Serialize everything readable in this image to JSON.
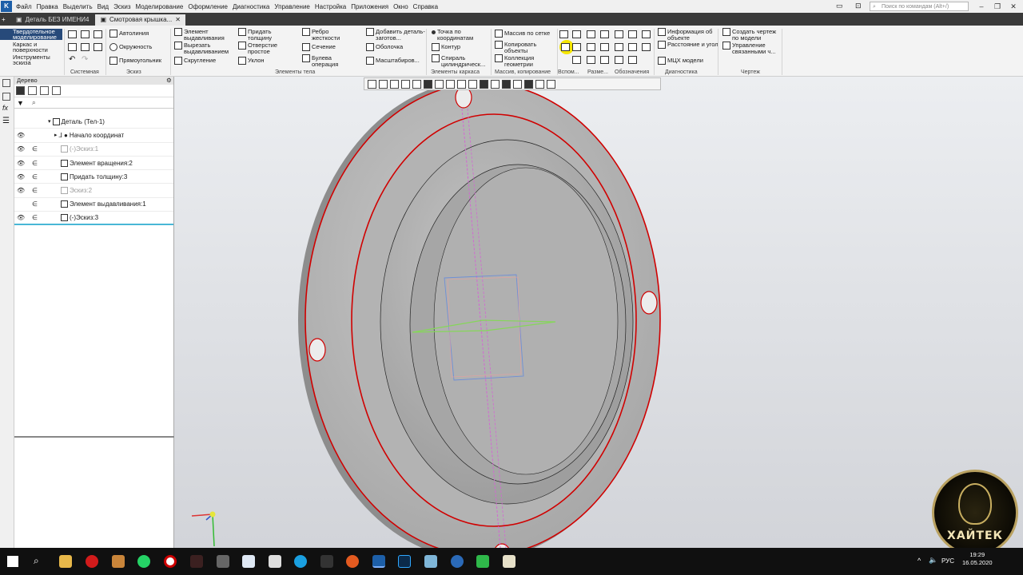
{
  "menu": [
    "Файл",
    "Правка",
    "Выделить",
    "Вид",
    "Эскиз",
    "Моделирование",
    "Оформление",
    "Диагностика",
    "Управление",
    "Настройка",
    "Приложения",
    "Окно",
    "Справка"
  ],
  "search_placeholder": "Поиск по командам (Alt+/)",
  "tabs": [
    "Деталь БЕЗ ИМЕНИ4",
    "Смотровая крышка..."
  ],
  "ribbon": {
    "modes": [
      "Твердотельное моделирование",
      "Каркас и поверхности",
      "Инструменты эскиза"
    ],
    "sketch": [
      "Автолиния",
      "Окружность",
      "Прямоугольник"
    ],
    "body1": [
      "Элемент выдавливания",
      "Вырезать выдавливанием",
      "Скругление"
    ],
    "body2": [
      "Придать толщину",
      "Отверстие простое",
      "Уклон"
    ],
    "body3": [
      "Ребро жесткости",
      "Сечение",
      "Булева операция"
    ],
    "body4": [
      "Добавить деталь-заготов...",
      "Оболочка",
      "Масштабиров..."
    ],
    "frame": [
      "Точка по координатам",
      "Контур",
      "Спираль цилиндрическ..."
    ],
    "array": [
      "Массив по сетке",
      "Копировать объекты",
      "Коллекция геометрии"
    ],
    "diag": [
      "Информация об объекте",
      "Расстояние и угол",
      "МЦХ модели"
    ],
    "drawing": [
      "Создать чертеж по модели",
      "Управление связанными ч..."
    ],
    "sections": [
      "Системная",
      "Эскиз",
      "Элементы тела",
      "Элементы каркаса",
      "Массив, копирование",
      "Вспом...",
      "Разме...",
      "Обозначения",
      "Диагностика",
      "Чертеж"
    ]
  },
  "tree": {
    "header": "Дерево",
    "rows": [
      {
        "label": "Деталь (Тел-1)",
        "eye": "",
        "rel": "",
        "muted": false
      },
      {
        "label": "Начало координат",
        "eye": "👁",
        "rel": "",
        "muted": false
      },
      {
        "label": "(-)Эскиз:1",
        "eye": "👁",
        "rel": "∈",
        "muted": true
      },
      {
        "label": "Элемент вращения:2",
        "eye": "👁",
        "rel": "∈",
        "muted": false
      },
      {
        "label": "Придать толщину:3",
        "eye": "👁",
        "rel": "∈",
        "muted": false
      },
      {
        "label": "Эскиз:2",
        "eye": "👁",
        "rel": "∈",
        "muted": true
      },
      {
        "label": "Элемент выдавливания:1",
        "eye": "",
        "rel": "∈",
        "muted": false
      },
      {
        "label": "(-)Эскиз:3",
        "eye": "👁",
        "rel": "∈",
        "muted": false
      }
    ]
  },
  "taskbar": {
    "lang": "РУС",
    "time": "19:29",
    "date": "16.05.2020"
  },
  "watermark": "ХАЙТЕК"
}
